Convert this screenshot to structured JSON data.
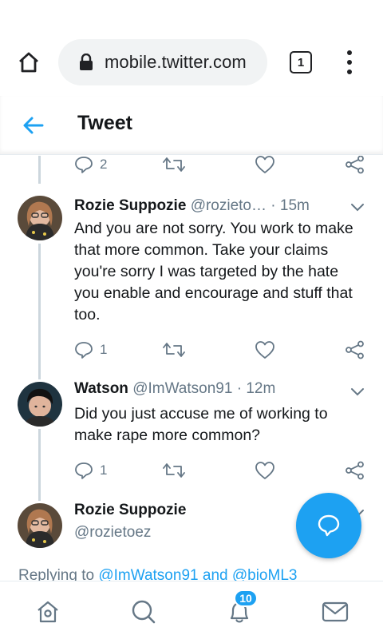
{
  "browser": {
    "url": "mobile.twitter.com",
    "tab_count": "1"
  },
  "header": {
    "title": "Tweet"
  },
  "tweets": [
    {
      "name": "",
      "handle": "",
      "time": "",
      "text": "",
      "reply_count": "2"
    },
    {
      "name": "Rozie Suppozie",
      "handle": "@rozieto…",
      "separator": "·",
      "time": "15m",
      "text": "And you are not sorry. You work to make that more common. Take your claims you're sorry I was targeted by the hate you enable and encourage and stuff that too.",
      "reply_count": "1"
    },
    {
      "name": "Watson",
      "handle": "@ImWatson91",
      "separator": "·",
      "time": "12m",
      "text": "Did you just accuse me of working to make rape more common?",
      "reply_count": "1"
    },
    {
      "name": "Rozie Suppozie",
      "handle": "@rozietoez"
    }
  ],
  "replying": {
    "prefix": "Replying to",
    "user1": "@ImWatson91",
    "and": "and",
    "user2": "@bioML3"
  },
  "bottom_nav": {
    "notifications_badge": "10"
  },
  "colors": {
    "accent": "#1da1f2",
    "secondary_text": "#657786",
    "primary_text": "#14171a"
  }
}
